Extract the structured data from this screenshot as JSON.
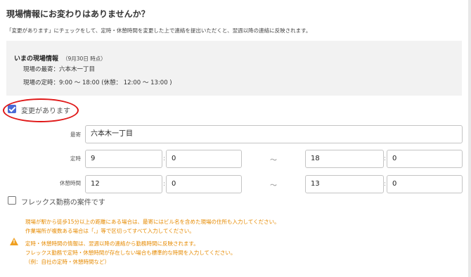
{
  "page": {
    "title": "現場情報にお変わりはありませんか？",
    "description": "「変更があります」にチェックをして、定時・休憩時間を変更した上で連絡を提出いただくと、翌週以降の連絡に反映されます。"
  },
  "current_info": {
    "heading": "いまの現場情報",
    "date": "（9月30日 時点）",
    "nearest_station_line": "現場の最寄：六本木一丁目",
    "hours_line": "現場の定時：9:00 ～ 18:00 (休憩： 12:00 ～ 13:00 )"
  },
  "change_checkbox": {
    "label": "変更があります",
    "checked": true
  },
  "form": {
    "station_label": "最寄",
    "station_value": "六本木一丁目",
    "hours_label": "定時",
    "hours_start_hour": "9",
    "hours_start_min": "0",
    "hours_end_hour": "18",
    "hours_end_min": "0",
    "break_label": "休憩時間",
    "break_start_hour": "12",
    "break_start_min": "0",
    "break_end_hour": "13",
    "break_end_min": "0",
    "colon": ":",
    "tilde": "～"
  },
  "flex_checkbox": {
    "label": "フレックス勤務の案件です",
    "checked": false
  },
  "notes": {
    "line1": "現場が駅から徒歩15分以上の距離にある場合は、最寄にはビル名を含めた現場の住所も入力してください。",
    "line2": "作業場所が複数ある場合は「,」等で区切ってすべて入力してください。",
    "line3": "定時・休憩時間の情報は、翌週以降の連絡から勤務時間に反映されます。",
    "line4": "フレックス勤務で定時・休憩時間が存在しない場合も標準的な時間を入力してください。",
    "line5": "（例：自社の定時・休憩時間など）"
  },
  "icons": {
    "warning": "warning-icon",
    "check": "checkmark-icon"
  },
  "colors": {
    "accent": "#4a6ad6",
    "highlight": "#e01818",
    "note": "#e68a00",
    "warning": "#f0a020"
  }
}
